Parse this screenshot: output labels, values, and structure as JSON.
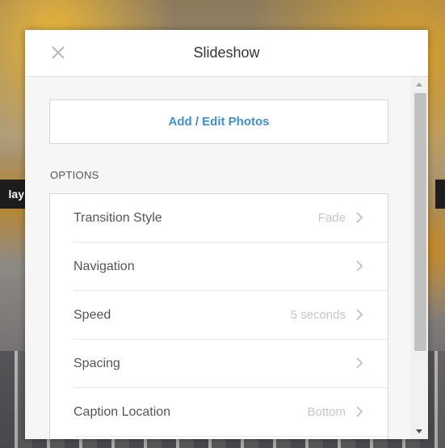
{
  "background": {
    "left_tag_text": "lay"
  },
  "modal": {
    "title": "Slideshow",
    "close_icon": "close-icon",
    "add_photos_label": "Add / Edit Photos",
    "options_heading": "OPTIONS",
    "options": [
      {
        "label": "Transition Style",
        "value": "Fade"
      },
      {
        "label": "Navigation",
        "value": ""
      },
      {
        "label": "Speed",
        "value": "5 seconds"
      },
      {
        "label": "Spacing",
        "value": ""
      },
      {
        "label": "Caption Location",
        "value": "Bottom"
      }
    ]
  },
  "colors": {
    "accent": "#3f8fcf",
    "muted_value": "#c6c6c6",
    "label_text": "#555555"
  }
}
